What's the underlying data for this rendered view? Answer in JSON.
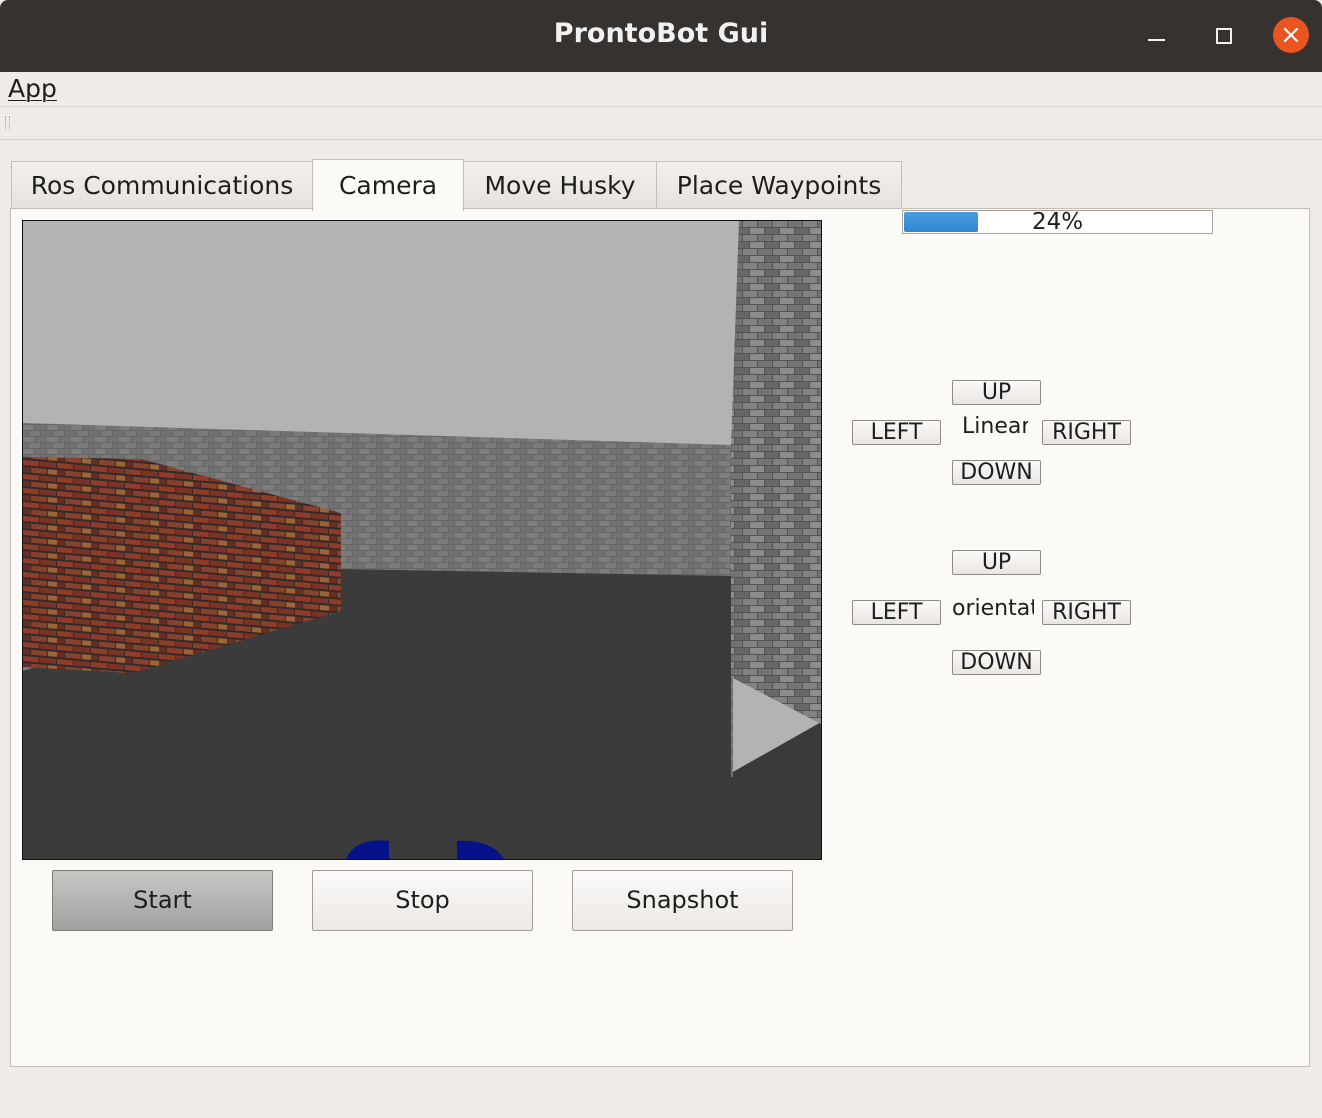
{
  "window": {
    "title": "ProntoBot Gui"
  },
  "menu": {
    "app_label": "App"
  },
  "tabs": [
    {
      "label": "Ros Communications"
    },
    {
      "label": "Camera"
    },
    {
      "label": "Move Husky"
    },
    {
      "label": "Place Waypoints"
    }
  ],
  "active_tab": "Camera",
  "progress": {
    "value_percent": 24,
    "label": "24%"
  },
  "linear_control": {
    "up_label": "UP",
    "left_label": "LEFT",
    "center_label": "Linear",
    "right_label": "RIGHT",
    "down_label": "DOWN"
  },
  "orientation_control": {
    "up_label": "UP",
    "left_label": "LEFT",
    "center_label": "orientation",
    "right_label": "RIGHT",
    "down_label": "DOWN"
  },
  "camera_buttons": {
    "start_label": "Start",
    "stop_label": "Stop",
    "snapshot_label": "Snapshot"
  },
  "colors": {
    "accent": "#2f86cf",
    "close_button": "#e95420",
    "titlebar": "#353230"
  }
}
